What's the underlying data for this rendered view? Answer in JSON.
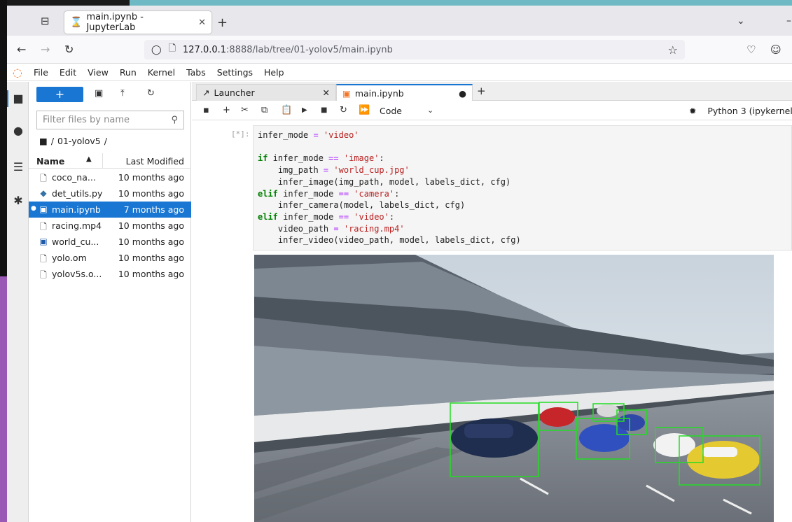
{
  "browser": {
    "tab_title": "main.ipynb - JupyterLab",
    "url_host": "127.0.0.1",
    "url_path": ":8888/lab/tree/01-yolov5/main.ipynb"
  },
  "menu": [
    "File",
    "Edit",
    "View",
    "Run",
    "Kernel",
    "Tabs",
    "Settings",
    "Help"
  ],
  "filebrowser": {
    "new_label": "+",
    "filter_placeholder": "Filter files by name",
    "breadcrumb_root": "/",
    "breadcrumb_folder": "01-yolov5",
    "breadcrumb_tail": "/",
    "col_name": "Name",
    "col_modified": "Last Modified",
    "files": [
      {
        "name": "coco_na...",
        "modified": "10 months ago",
        "icon": "file-icon"
      },
      {
        "name": "det_utils.py",
        "modified": "10 months ago",
        "icon": "python-icon"
      },
      {
        "name": "main.ipynb",
        "modified": "7 months ago",
        "icon": "notebook-icon"
      },
      {
        "name": "racing.mp4",
        "modified": "10 months ago",
        "icon": "file-icon"
      },
      {
        "name": "world_cu...",
        "modified": "10 months ago",
        "icon": "image-icon"
      },
      {
        "name": "yolo.om",
        "modified": "10 months ago",
        "icon": "file-icon"
      },
      {
        "name": "yolov5s.o...",
        "modified": "10 months ago",
        "icon": "file-icon"
      }
    ]
  },
  "doc_tabs": [
    {
      "label": "Launcher"
    },
    {
      "label": "main.ipynb"
    }
  ],
  "notebook": {
    "cell_type": "Code",
    "kernel": "Python 3 (ipykernel)",
    "prompt": "[*]:"
  },
  "colors": {
    "accent": "#1976d2",
    "jupyter_orange": "#f37726",
    "bbox_green": "#22dd22"
  }
}
